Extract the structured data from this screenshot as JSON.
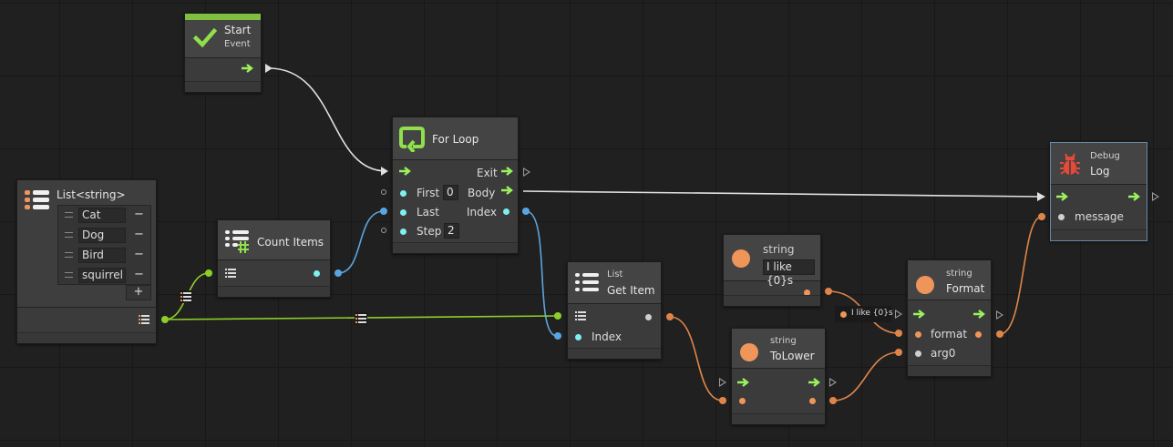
{
  "colors": {
    "background": "#202020",
    "node": "#3b3b3b",
    "flow_arrow": "#9cf25c",
    "port_cyan": "#7ff0ef",
    "port_orange": "#f0955a",
    "wire_flow": "#e0e0e0",
    "wire_int": "#5aa5e0",
    "wire_list": "#8ccf2a",
    "wire_string": "#e0854a",
    "start_bar": "#7fbf3f",
    "debug_accent": "#e34a3a"
  },
  "start_node": {
    "title": "Start",
    "subtitle": "Event",
    "icon": "check-icon"
  },
  "for_loop": {
    "title": "For Loop",
    "icon": "loop-icon",
    "exit_label": "Exit",
    "body_label": "Body",
    "index_label": "Index",
    "first_label": "First",
    "first_value": "0",
    "last_label": "Last",
    "step_label": "Step",
    "step_value": "2"
  },
  "list_node": {
    "title": "List<string>",
    "icon": "list-icon",
    "items": [
      "Cat",
      "Dog",
      "Bird",
      "squirrel"
    ],
    "remove_label": "−",
    "add_label": "+"
  },
  "count_items": {
    "title": "Count Items",
    "icon": "list-count-icon"
  },
  "get_item": {
    "subtitle": "List",
    "title": "Get Item",
    "index_label": "Index",
    "icon": "list-icon"
  },
  "string_literal": {
    "subtitle": "string",
    "value": "I like {0}s"
  },
  "to_lower": {
    "subtitle": "string",
    "title": "ToLower"
  },
  "format": {
    "subtitle": "string",
    "title": "Format",
    "format_label": "format",
    "arg_label": "arg0"
  },
  "inline_value": "I like {0}s",
  "debug_log": {
    "subtitle": "Debug",
    "title": "Log",
    "message_label": "message",
    "icon": "bug-icon"
  }
}
